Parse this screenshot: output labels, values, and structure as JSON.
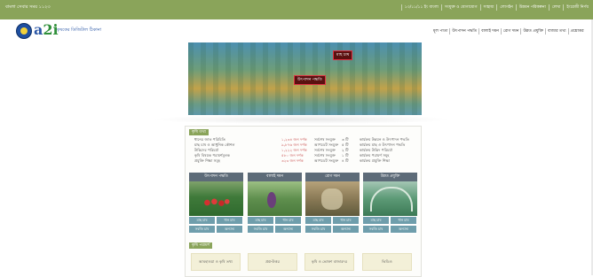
{
  "topbar": {
    "left_text": "বাংলা সেবার সময় ১১২৩",
    "links": [
      "১৩/১১/১১ ইং বাংলা",
      "সংযুক্ত ও যোগাযোগ",
      "সাহায্য",
      "লোগইন",
      "উন্নয়ন পরিকল্পনা",
      "লেখা",
      "ইংরেজী নির্ণয়"
    ]
  },
  "header": {
    "logo_text_a": "a",
    "logo_text_b": "2i",
    "tagline": "কৃষকের ডিজিটাল ঠিকানা",
    "menu": [
      "মূল পাতা",
      "উৎপাদন পদ্ধতি",
      "বালাই দমন",
      "রোগ দমন",
      "উন্নত প্রযুক্তি",
      "বাজার তথ্য",
      "প্রশ্নোত্তর"
    ]
  },
  "banner": {
    "tag1": "মাছ চাষ",
    "tag2": "উৎপাদন পদ্ধতি"
  },
  "info_section": {
    "title": "কৃষি তথ্য",
    "rows": [
      {
        "name": "ধানের জাত পরিচিতি",
        "value": "১,২৩৪ জন দর্শক",
        "label": "সর্বশেষ সংযুক্ত",
        "count": "৩ টি",
        "note": "কার্যক্রম উন্নয়ন ও উৎপাদন পদ্ধতি"
      },
      {
        "name": "মাছ চাষ ও আধুনিক কৌশল",
        "value": "৯,৮৭৬ জন দর্শক",
        "label": "আপডেট সংযুক্ত",
        "count": "৫ টি",
        "note": "কার্যক্রম মাছ ও উৎপাদন পদ্ধতি"
      },
      {
        "name": "উদ্ভিদের পরিচর্যা",
        "value": "১,২২২ জন দর্শক",
        "label": "সর্বশেষ সংযুক্ত",
        "count": "২ টি",
        "note": "কার্যক্রম উদ্ভিদ পরিচর্যা"
      },
      {
        "name": "কৃষি বিষয়ক পরামর্শমূলক",
        "value": "৫৮০ জন দর্শক",
        "label": "সর্বশেষ সংযুক্ত",
        "count": "১ টি",
        "note": "কার্যক্রম পরামর্শ সমূহ"
      },
      {
        "name": "প্রযুক্তি শিক্ষা সমূহ",
        "value": "৩২৩ জন দর্শক",
        "label": "আপডেট সংযুক্ত",
        "count": "৪ টি",
        "note": "কার্যক্রম প্রযুক্তি শিক্ষা"
      }
    ]
  },
  "cards": [
    {
      "title": "উৎপাদন পদ্ধতি",
      "b1": "মাছ চাষ",
      "b2": "ধান চাষ",
      "b3": "সবজি চাষ",
      "b4": "অন্যান্য"
    },
    {
      "title": "বালাই দমন",
      "b1": "মাছ চাষ",
      "b2": "ধান চাষ",
      "b3": "সবজি চাষ",
      "b4": "অন্যান্য"
    },
    {
      "title": "রোগ দমন",
      "b1": "মাছ চাষ",
      "b2": "ধান চাষ",
      "b3": "সবজি চাষ",
      "b4": "অন্যান্য"
    },
    {
      "title": "উন্নত প্রযুক্তি",
      "b1": "মাছ চাষ",
      "b2": "ধান চাষ",
      "b3": "সবজি চাষ",
      "b4": "অন্যান্য"
    }
  ],
  "quick_section": {
    "title": "কৃষি পরামর্শ",
    "links": [
      "আবহাওয়া ও কৃষি তথ্য",
      "প্রশ্ন-উত্তর",
      "কৃষি ও ভোক্তা বাজারদর",
      "ভিডিও"
    ]
  }
}
